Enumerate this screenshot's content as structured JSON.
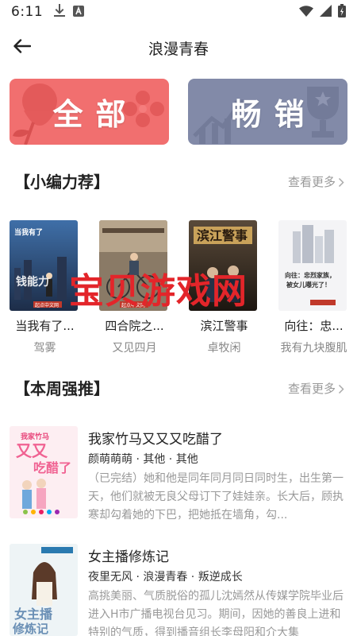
{
  "status_bar": {
    "time": "6:11",
    "left_icons": [
      "download-icon",
      "a-badge-icon"
    ],
    "right_icons": [
      "wifi-icon",
      "signal-icon",
      "battery-icon"
    ]
  },
  "header": {
    "title": "浪漫青春",
    "back_icon": "back-arrow-icon"
  },
  "categories": [
    {
      "label": "全部",
      "color": "#f16f6f"
    },
    {
      "label": "畅销",
      "color": "#828aa8"
    }
  ],
  "editor_section": {
    "title": "【小编力荐】",
    "more": "查看更多"
  },
  "editor_books": [
    {
      "title": "当我有了...",
      "author": "驾雾",
      "cover_text": "当我有了钱能力",
      "cover_badge": "起点中文网"
    },
    {
      "title": "四合院之...",
      "author": "又见四月",
      "cover_text": "",
      "cover_badge": "起点中文网"
    },
    {
      "title": "滨江警事",
      "author": "卓牧闲",
      "cover_text": "滨江警事",
      "cover_badge": ""
    },
    {
      "title": "向往：忠...",
      "author": "我有九块腹肌",
      "cover_text": "向往：忠烈家族，被女儿曝光了！",
      "cover_badge": ""
    }
  ],
  "watermark": "宝贝游戏网",
  "weekly_section": {
    "title": "【本周强推】",
    "more": "查看更多"
  },
  "weekly_books": [
    {
      "title": "我家竹马又又又吃醋了",
      "meta": "颜萌萌萌 · 其他 · 其他",
      "desc": "（已完结）她和他是同年同月同日同时生，出生第一天，他们就被无良父母订下了娃娃亲。长大后，顾执寒却勾着她的下巴，把她抵在墙角，勾...",
      "cover_text": "我家竹马又又又吃醋了"
    },
    {
      "title": "女主播修炼记",
      "meta": "夜里无风 · 浪漫青春 · 叛逆成长",
      "desc": "高挑美丽、气质脱俗的孤儿沈嫣然从传媒学院毕业后进入H市广播电视台见习。期间，因她的善良上进和特别的气质，得到播音组长李母阳和介大集",
      "cover_text": "女主播修炼记"
    }
  ]
}
